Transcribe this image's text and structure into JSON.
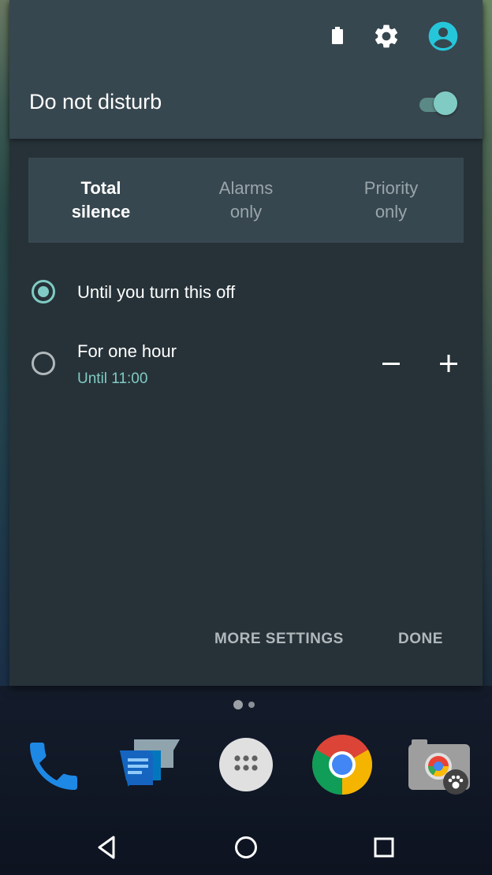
{
  "quick_settings": {
    "status_icons": [
      "battery-icon",
      "gear-icon",
      "account-icon"
    ],
    "accent_color": "#80cbc4"
  },
  "dnd": {
    "title": "Do not disturb",
    "enabled": true
  },
  "modes": [
    {
      "label": "Total\nsilence",
      "selected": true
    },
    {
      "label": "Alarms\nonly",
      "selected": false
    },
    {
      "label": "Priority\nonly",
      "selected": false
    }
  ],
  "options": {
    "until_off": {
      "label": "Until you turn this off",
      "checked": true
    },
    "one_hour": {
      "label": "For one hour",
      "sublabel": "Until 11:00",
      "checked": false
    }
  },
  "footer": {
    "more_settings": "MORE SETTINGS",
    "done": "DONE"
  },
  "home": {
    "page_count": 2,
    "current_page": 1,
    "dock": [
      "phone-icon",
      "messenger-icon",
      "app-drawer-icon",
      "chrome-icon",
      "camera-icon"
    ]
  },
  "navbar": [
    "back-icon",
    "home-icon",
    "recents-icon"
  ]
}
